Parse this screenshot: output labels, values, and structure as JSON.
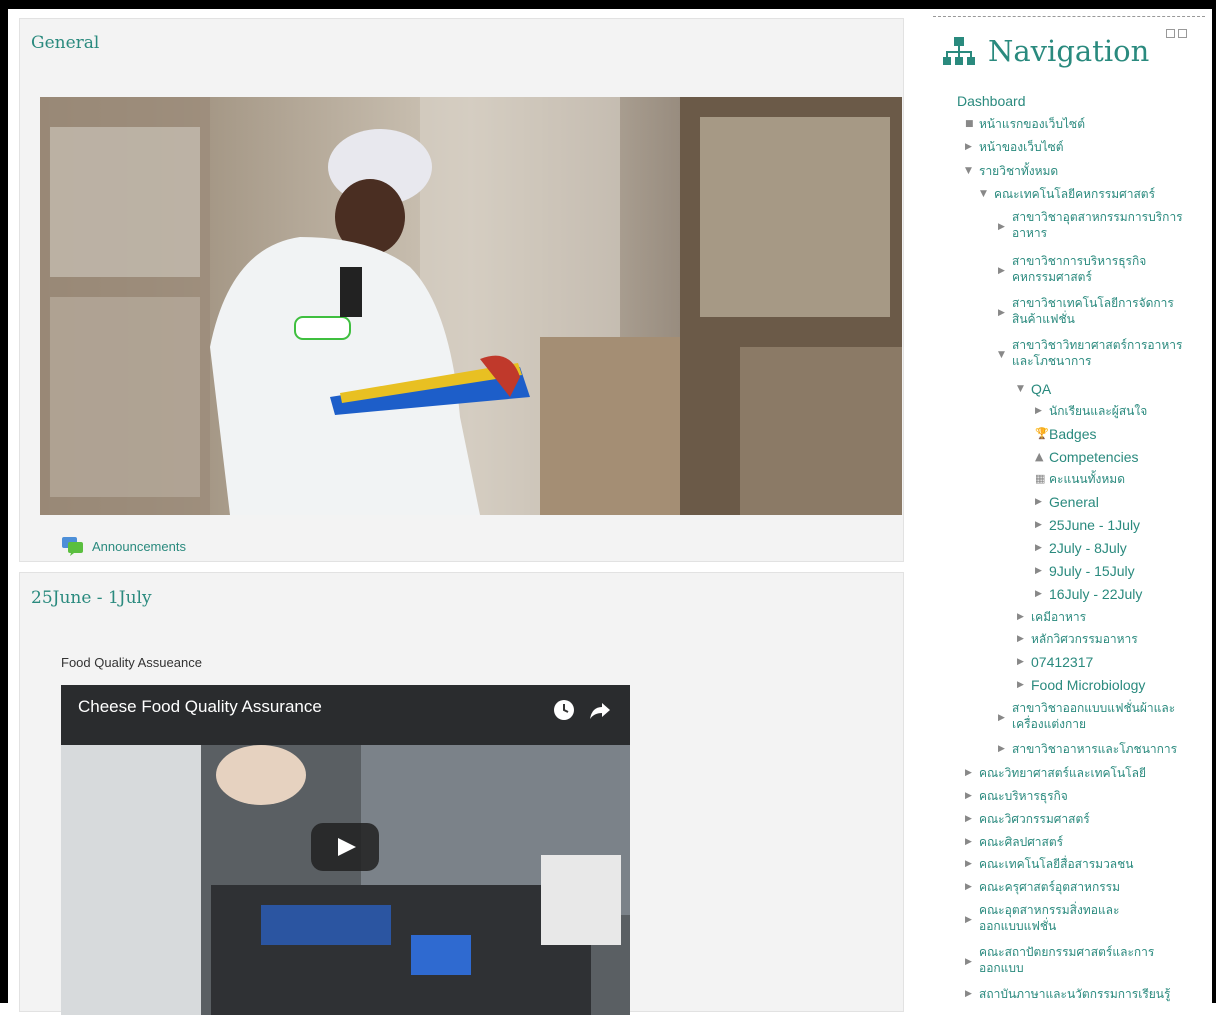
{
  "sections": [
    {
      "title": "General",
      "activity_label": "Announcements"
    },
    {
      "title": "25June - 1July",
      "content_label": "Food Quality Assueance",
      "video_title": "Cheese Food Quality Assurance"
    }
  ],
  "nav": {
    "title": "Navigation",
    "items": [
      {
        "label": "Dashboard",
        "marker": "none"
      },
      {
        "label": "หน้าแรกของเว็บไซต์",
        "marker": "bullet"
      },
      {
        "label": "หน้าของเว็บไซต์",
        "marker": "right"
      },
      {
        "label": "รายวิชาทั้งหมด",
        "marker": "down"
      },
      {
        "label": "คณะเทคโนโลยีคหกรรมศาสตร์",
        "marker": "down"
      },
      {
        "label": "สาขาวิชาอุตสาหกรรมการบริการ",
        "label2": "อาหาร",
        "marker": "right"
      },
      {
        "label": "สาขาวิชาการบริหารธุรกิจ",
        "label2": "คหกรรมศาสตร์",
        "marker": "right"
      },
      {
        "label": "สาขาวิชาเทคโนโลยีการจัดการ",
        "label2": "สินค้าแฟชั่น",
        "marker": "right"
      },
      {
        "label": "สาขาวิชาวิทยาศาสตร์การอาหาร",
        "label2": "และโภชนาการ",
        "marker": "down"
      },
      {
        "label": "QA",
        "marker": "down"
      },
      {
        "label": "นักเรียนและผู้สนใจ",
        "marker": "right"
      },
      {
        "label": "Badges",
        "marker": "trophy"
      },
      {
        "label": "Competencies",
        "marker": "triangle"
      },
      {
        "label": "คะแนนทั้งหมด",
        "marker": "table"
      },
      {
        "label": "General",
        "marker": "right"
      },
      {
        "label": "25June - 1July",
        "marker": "right"
      },
      {
        "label": "2July - 8July",
        "marker": "right"
      },
      {
        "label": "9July - 15July",
        "marker": "right"
      },
      {
        "label": "16July - 22July",
        "marker": "right"
      },
      {
        "label": "เคมีอาหาร",
        "marker": "right"
      },
      {
        "label": "หลักวิศวกรรมอาหาร",
        "marker": "right"
      },
      {
        "label": "07412317",
        "marker": "right"
      },
      {
        "label": "Food Microbiology",
        "marker": "right"
      },
      {
        "label": "สาขาวิชาออกแบบแฟชั่นผ้าและ",
        "label2": "เครื่องแต่งกาย",
        "marker": "right"
      },
      {
        "label": "สาขาวิชาอาหารและโภชนาการ",
        "marker": "right"
      },
      {
        "label": "คณะวิทยาศาสตร์และเทคโนโลยี",
        "marker": "right"
      },
      {
        "label": "คณะบริหารธุรกิจ",
        "marker": "right"
      },
      {
        "label": "คณะวิศวกรรมศาสตร์",
        "marker": "right"
      },
      {
        "label": "คณะศิลปศาสตร์",
        "marker": "right"
      },
      {
        "label": "คณะเทคโนโลยีสื่อสารมวลชน",
        "marker": "right"
      },
      {
        "label": "คณะครุศาสตร์อุตสาหกรรม",
        "marker": "right"
      },
      {
        "label": "คณะอุตสาหกรรมสิ่งทอและ",
        "label2": "ออกแบบแฟชั่น",
        "marker": "right"
      },
      {
        "label": "คณะสถาปัตยกรรมศาสตร์และการ",
        "label2": "ออกแบบ",
        "marker": "right"
      },
      {
        "label": "สถาบันภาษาและนวัตกรรมการเรียนรู้",
        "marker": "right"
      }
    ]
  }
}
